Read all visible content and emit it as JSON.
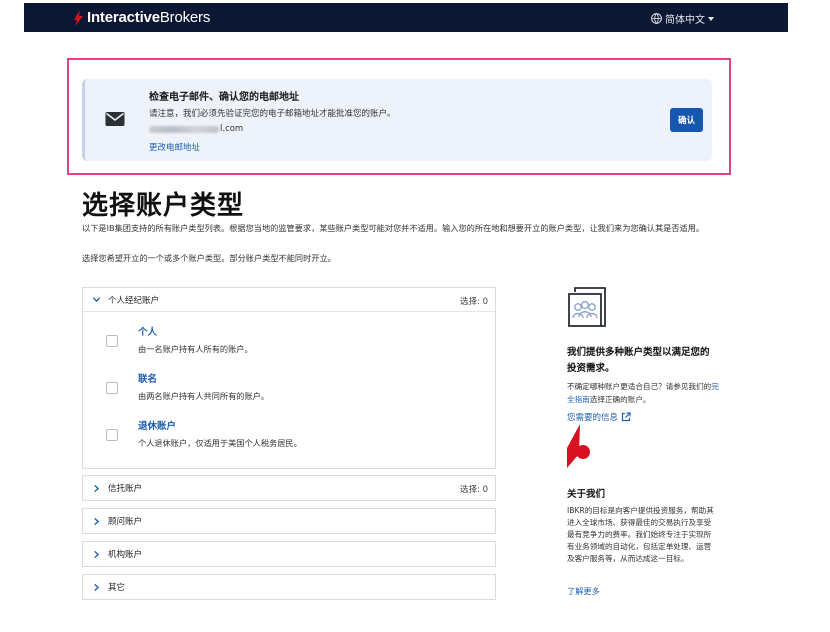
{
  "header": {
    "brand_bold": "Interactive",
    "brand_light": "Brokers",
    "language": "简体中文"
  },
  "alert": {
    "title": "检查电子邮件、确认您的电邮地址",
    "body": "请注意，我们必须先验证完您的电子邮箱地址才能批准您的账户。",
    "email_suffix": "l.com",
    "change_link": "更改电邮地址",
    "confirm_button": "确认"
  },
  "main": {
    "title": "选择账户类型",
    "intro": "以下是IB集团支持的所有账户类型列表。根据您当地的监管要求，某些账户类型可能对您并不适用。输入您的所在地和想要开立的账户类型，让我们来为您确认其是否适用。",
    "instruction": "选择您希望开立的一个或多个账户类型。部分账户类型不能同时开立。"
  },
  "sections": [
    {
      "label": "个人经纪账户",
      "count": "选择: 0",
      "expanded": true,
      "options": [
        {
          "title": "个人",
          "desc": "由一名账户持有人所有的账户。"
        },
        {
          "title": "联名",
          "desc": "由两名账户持有人共同所有的账户。"
        },
        {
          "title": "退休账户",
          "desc": "个人退休账户，仅适用于美国个人税务居民。"
        }
      ]
    },
    {
      "label": "信托账户",
      "count": "选择: 0",
      "expanded": false
    },
    {
      "label": "顾问账户",
      "count": "",
      "expanded": false
    },
    {
      "label": "机构账户",
      "count": "",
      "expanded": false
    },
    {
      "label": "其它",
      "count": "",
      "expanded": false
    }
  ],
  "sidebar": {
    "heading": "我们提供多种账户类型以满足您的投资需求。",
    "text_before_link": "不确定哪种账户更适合自己？请参见我们的",
    "guide_link": "完全指南",
    "text_after_link": "选择正确的账户。",
    "info_link": "您需要的信息",
    "about_title": "关于我们",
    "about_text": "IBKR的目标是向客户提供投资服务，帮助其进入全球市场、获得最佳的交易执行及享受最有竞争力的费率。我们始终专注于实现所有业务领域的自动化，包括定单处理、运营及客户服务等，从而达成这一目标。",
    "learn_more": "了解更多"
  },
  "colors": {
    "topbar": "#0c1833",
    "accent_blue": "#1657b0",
    "link_blue": "#1f5fae",
    "highlight_pink": "#e0428b",
    "brand_red": "#d81222"
  }
}
